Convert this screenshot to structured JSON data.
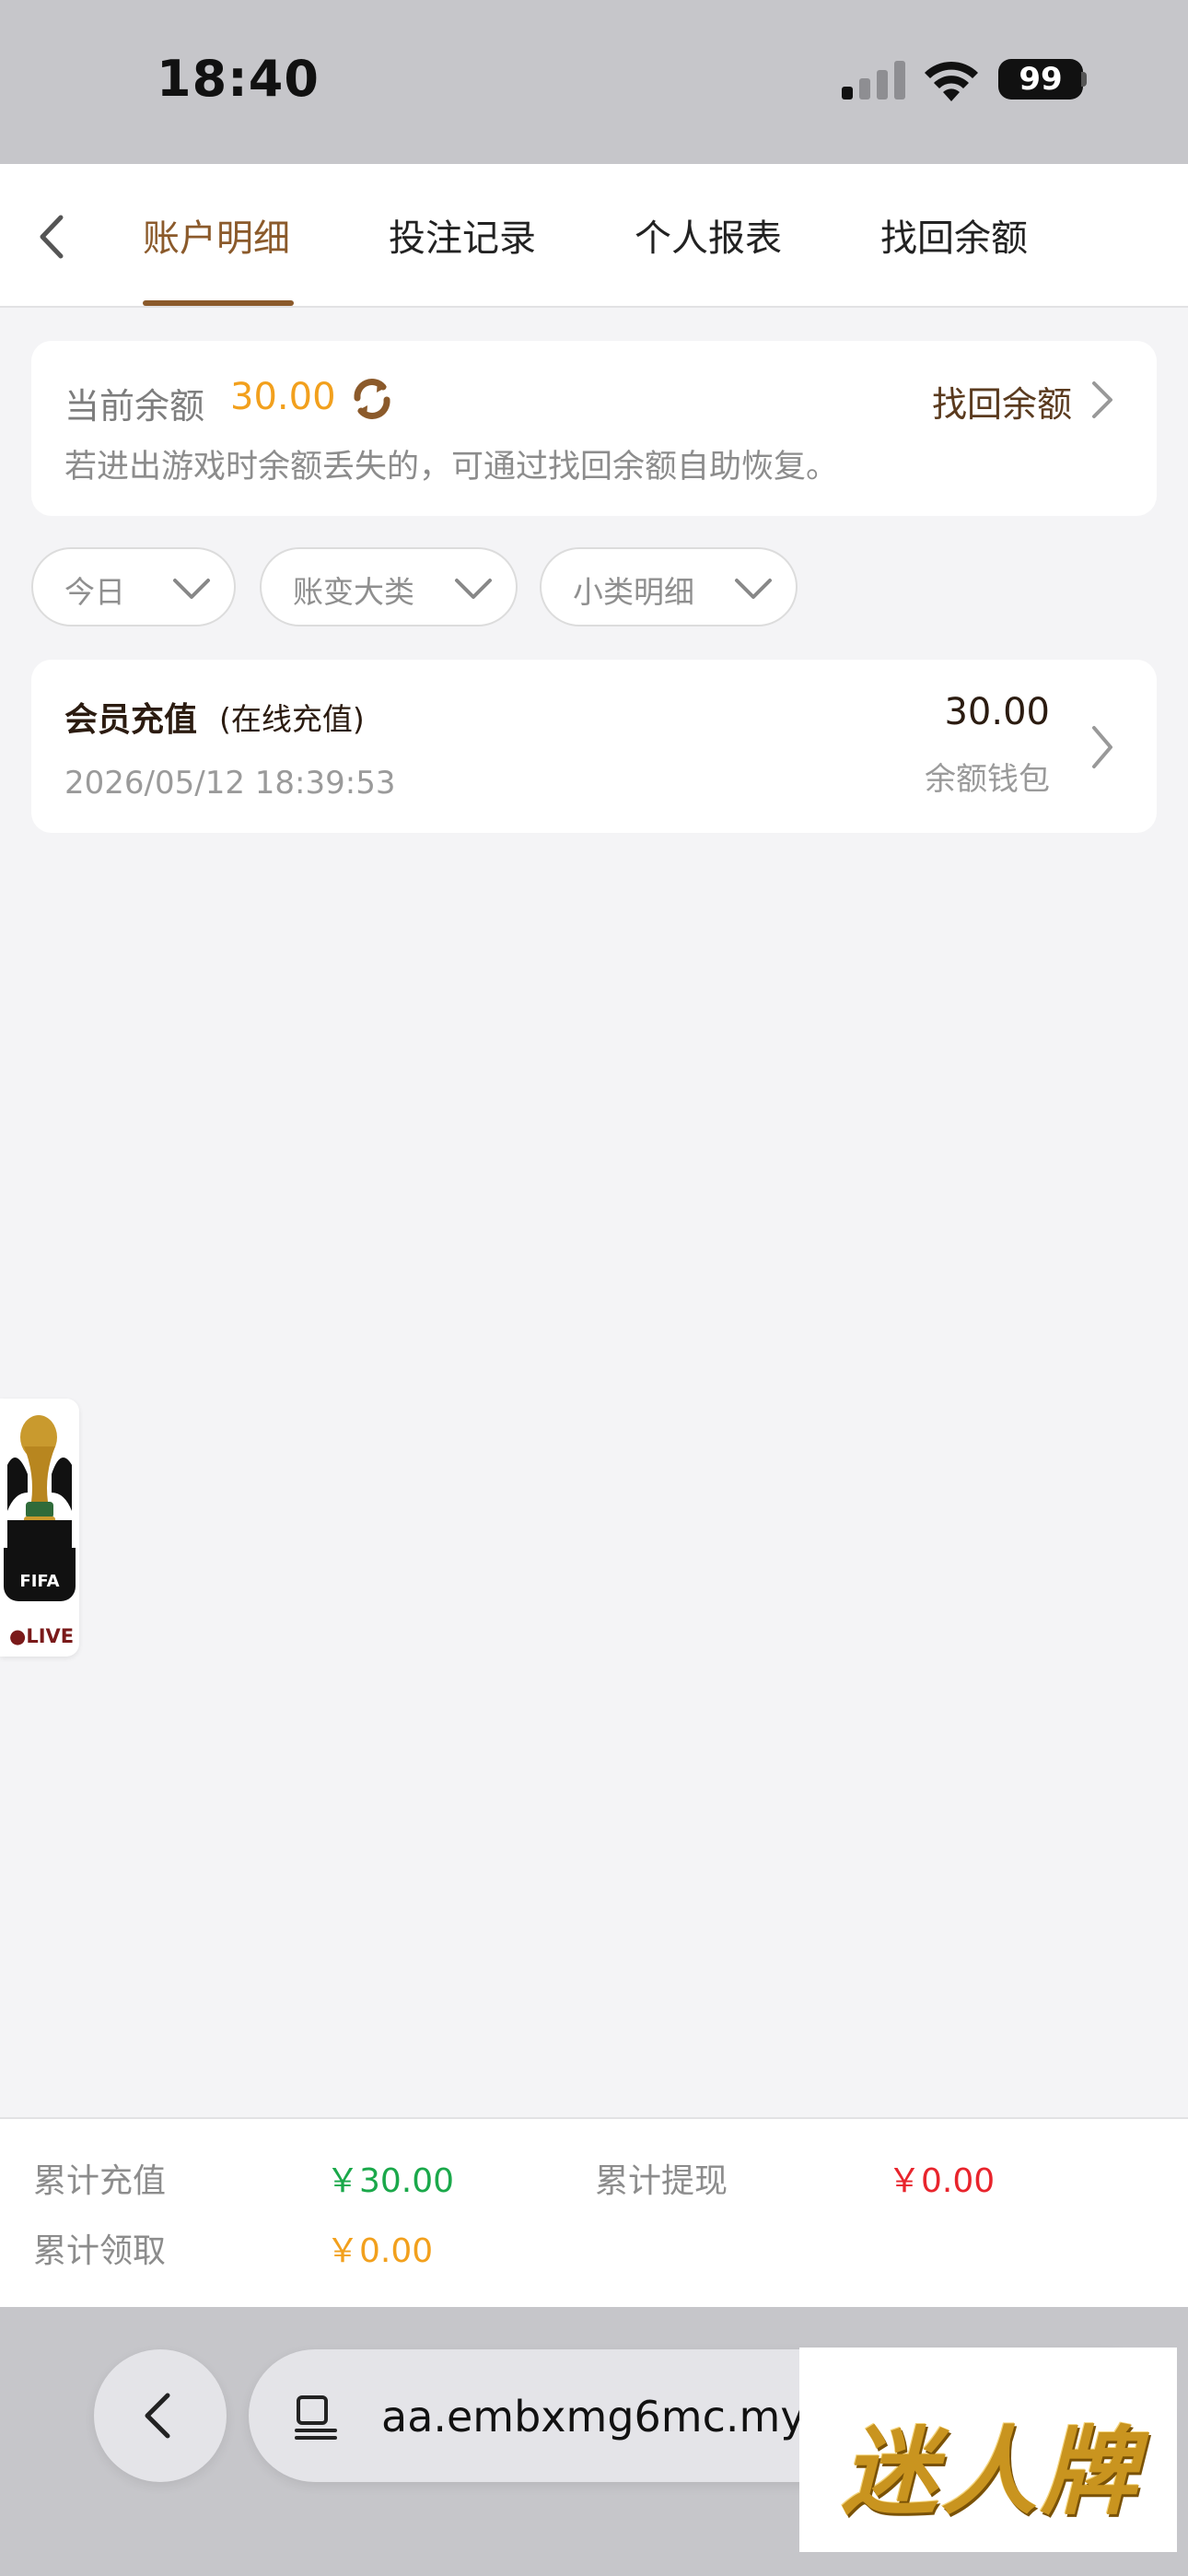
{
  "status_bar": {
    "time": "18:40",
    "battery": "99"
  },
  "header": {
    "tabs": [
      {
        "label": "账户明细",
        "active": true
      },
      {
        "label": "投注记录",
        "active": false
      },
      {
        "label": "个人报表",
        "active": false
      },
      {
        "label": "找回余额",
        "active": false
      }
    ]
  },
  "balance": {
    "label": "当前余额",
    "value": "30.00",
    "recover_label": "找回余额",
    "hint": "若进出游戏时余额丢失的，可通过找回余额自助恢复。"
  },
  "filters": [
    {
      "label": "今日"
    },
    {
      "label": "账变大类"
    },
    {
      "label": "小类明细"
    }
  ],
  "records": [
    {
      "title": "会员充值",
      "subtitle": "(在线充值)",
      "datetime": "2026/05/12 18:39:53",
      "amount": "30.00",
      "wallet": "余额钱包"
    }
  ],
  "badge": {
    "org": "FIFA",
    "live": "●LIVE"
  },
  "summary": {
    "total_recharge_label": "累计充值",
    "total_recharge_value": "￥30.00",
    "total_withdraw_label": "累计提现",
    "total_withdraw_value": "￥0.00",
    "total_claim_label": "累计领取",
    "total_claim_value": "￥0.00"
  },
  "browser": {
    "url": "aa.embxmg6mc.my"
  },
  "logo": {
    "text": "迷人牌"
  },
  "colors": {
    "accent": "#8b5a2b",
    "balance": "#f2a01d",
    "positive": "#1aa84a",
    "negative": "#e8242c"
  }
}
